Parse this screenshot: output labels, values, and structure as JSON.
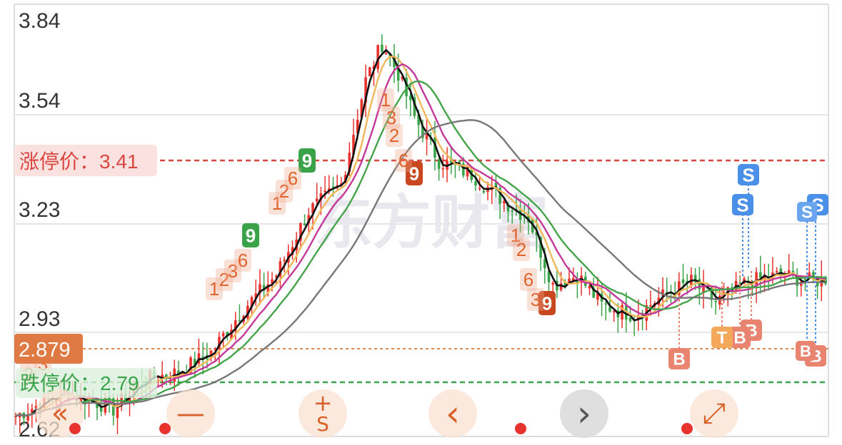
{
  "chart_data": {
    "type": "candlestick",
    "y_ticks": [
      "3.84",
      "3.54",
      "3.23",
      "2.93",
      "2.62"
    ],
    "ylim": [
      2.62,
      3.84
    ],
    "limit_up": {
      "label": "涨停价：",
      "value": "3.41"
    },
    "limit_down": {
      "label": "跌停价：",
      "value": "2.79"
    },
    "price_tag": {
      "value": "2.879"
    },
    "grid": true,
    "watermark": "东方财富",
    "moving_averages": [
      {
        "color": "#111111"
      },
      {
        "color": "#f0b85a"
      },
      {
        "color": "#c4389a"
      },
      {
        "color": "#45a34a"
      },
      {
        "color": "#777777"
      }
    ],
    "signals": {
      "td_up": [
        "1",
        "2",
        "3",
        "6",
        "9"
      ],
      "td_down": [
        "9",
        "9"
      ],
      "buy": "B",
      "sell": "S",
      "t": "T"
    }
  },
  "controls": [
    {
      "name": "collapse-left-button",
      "symbol": "«"
    },
    {
      "name": "minus-button",
      "symbol": "—"
    },
    {
      "name": "s-mark-button",
      "symbol": "S"
    },
    {
      "name": "prev-button",
      "symbol": "‹"
    },
    {
      "name": "next-button",
      "symbol": "›"
    },
    {
      "name": "fullscreen-button",
      "symbol": "⤢"
    }
  ],
  "colors": {
    "up": "#e8322d",
    "down": "#3aa34a",
    "accent": "#d9622b"
  }
}
